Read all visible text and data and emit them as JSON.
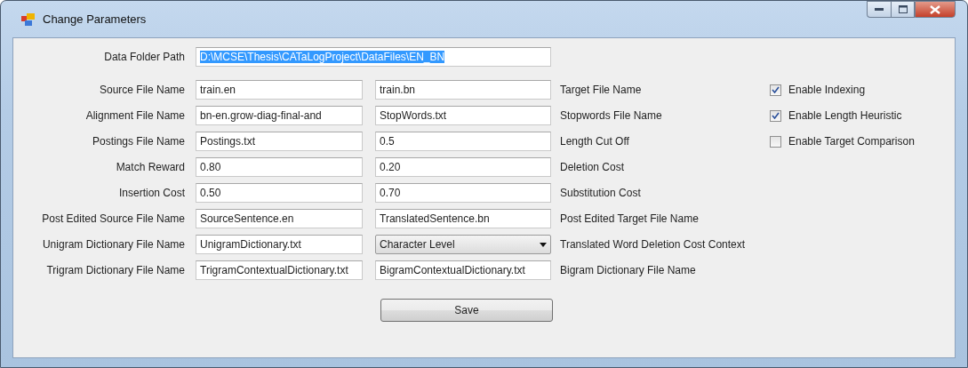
{
  "window": {
    "title": "Change Parameters"
  },
  "data_folder": {
    "label": "Data Folder Path",
    "value": "D:\\MCSE\\Thesis\\CATaLogProject\\DataFiles\\EN_BN",
    "highlighted": true
  },
  "rows": [
    {
      "label": "Source File Name",
      "left": {
        "kind": "text",
        "value": "train.en"
      },
      "right": {
        "kind": "text",
        "value": "train.bn"
      },
      "right_label": "Target File Name"
    },
    {
      "label": "Alignment File Name",
      "left": {
        "kind": "text",
        "value": "bn-en.grow-diag-final-and"
      },
      "right": {
        "kind": "text",
        "value": "StopWords.txt"
      },
      "right_label": "Stopwords File Name"
    },
    {
      "label": "Postings File Name",
      "left": {
        "kind": "text",
        "value": "Postings.txt"
      },
      "right": {
        "kind": "text",
        "value": "0.5"
      },
      "right_label": "Length Cut Off"
    },
    {
      "label": "Match Reward",
      "left": {
        "kind": "text",
        "value": "0.80"
      },
      "right": {
        "kind": "text",
        "value": "0.20"
      },
      "right_label": "Deletion Cost"
    },
    {
      "label": "Insertion Cost",
      "left": {
        "kind": "text",
        "value": "0.50"
      },
      "right": {
        "kind": "text",
        "value": "0.70"
      },
      "right_label": "Substitution Cost"
    },
    {
      "label": "Post Edited Source File Name",
      "left": {
        "kind": "text",
        "value": "SourceSentence.en"
      },
      "right": {
        "kind": "text",
        "value": "TranslatedSentence.bn"
      },
      "right_label": "Post Edited Target File Name"
    },
    {
      "label": "Unigram Dictionary File Name",
      "left": {
        "kind": "text",
        "value": "UnigramDictionary.txt"
      },
      "right": {
        "kind": "dropdown",
        "value": "Character Level"
      },
      "right_label": "Translated Word Deletion Cost Context"
    },
    {
      "label": "Trigram Dictionary File Name",
      "left": {
        "kind": "text",
        "value": "TrigramContextualDictionary.txt"
      },
      "right": {
        "kind": "text",
        "value": "BigramContextualDictionary.txt"
      },
      "right_label": "Bigram Dictionary File Name"
    }
  ],
  "options": [
    {
      "label": "Enable Indexing",
      "checked": true
    },
    {
      "label": "Enable Length Heuristic",
      "checked": true
    },
    {
      "label": "Enable Target Comparison",
      "checked": false
    }
  ],
  "buttons": [
    "Save"
  ]
}
